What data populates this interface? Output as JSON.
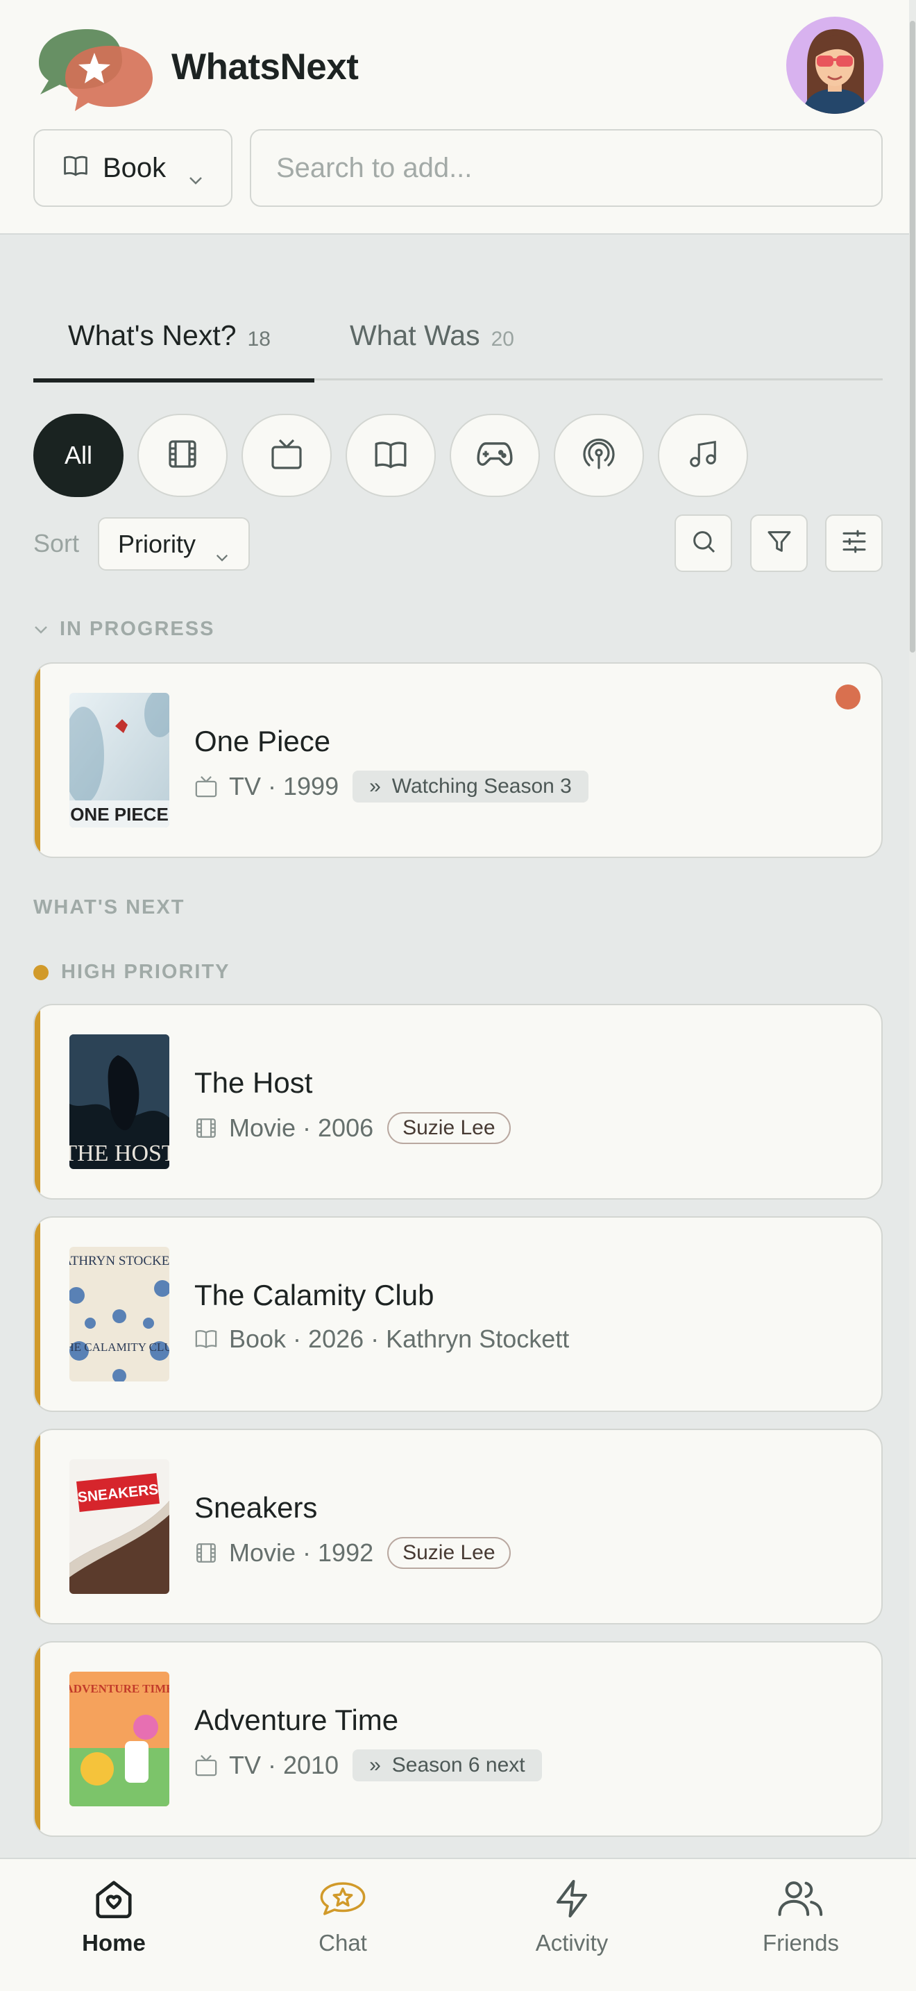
{
  "header": {
    "brand": "WhatsNext",
    "type_select": {
      "value": "Book"
    },
    "search": {
      "placeholder": "Search to add..."
    }
  },
  "tabs": [
    {
      "label": "What's Next?",
      "count": "18",
      "active": true
    },
    {
      "label": "What Was",
      "count": "20",
      "active": false
    }
  ],
  "filters": {
    "all_label": "All",
    "chips": [
      "film-icon",
      "tv-icon",
      "book-icon",
      "gamepad-icon",
      "podcast-icon",
      "music-icon"
    ]
  },
  "sort": {
    "label": "Sort",
    "value": "Priority"
  },
  "sections": {
    "in_progress": "IN PROGRESS",
    "whats_next": "WHAT'S NEXT",
    "high_priority": "HIGH PRIORITY"
  },
  "in_progress": [
    {
      "title": "One Piece",
      "type": "TV",
      "year": "1999",
      "progress": "Watching Season 3",
      "icon": "tv-icon",
      "unread": true
    }
  ],
  "high_priority": [
    {
      "title": "The Host",
      "meta": "Movie · 2006",
      "tag": "Suzie Lee",
      "icon": "film-icon"
    },
    {
      "title": "The Calamity Club",
      "meta": "Book · 2026 · Kathryn Stockett",
      "icon": "book-icon"
    },
    {
      "title": "Sneakers",
      "meta": "Movie · 1992",
      "tag": "Suzie Lee",
      "icon": "film-icon"
    },
    {
      "title": "Adventure Time",
      "meta": "TV · 2010",
      "progress": "Season 6 next",
      "icon": "tv-icon"
    }
  ],
  "posters": {
    "one_piece": "ONE PIECE",
    "the_host": "THE HOST",
    "calamity_author": "KATHRYN STOCKETT",
    "calamity_title": "THE CALAMITY CLUB",
    "sneakers": "SNEAKERS",
    "adventure_time": "ADVENTURE TIME"
  },
  "nav": [
    {
      "label": "Home",
      "icon": "home-icon",
      "active": true
    },
    {
      "label": "Chat",
      "icon": "chat-icon",
      "active": false
    },
    {
      "label": "Activity",
      "icon": "lightning-icon",
      "active": false
    },
    {
      "label": "Friends",
      "icon": "friends-icon",
      "active": false
    }
  ],
  "colors": {
    "accent": "#d19a2a",
    "unread_dot": "#d9704f",
    "active_chip": "#1a2321",
    "avatar_bg": "#d8b2ef"
  }
}
